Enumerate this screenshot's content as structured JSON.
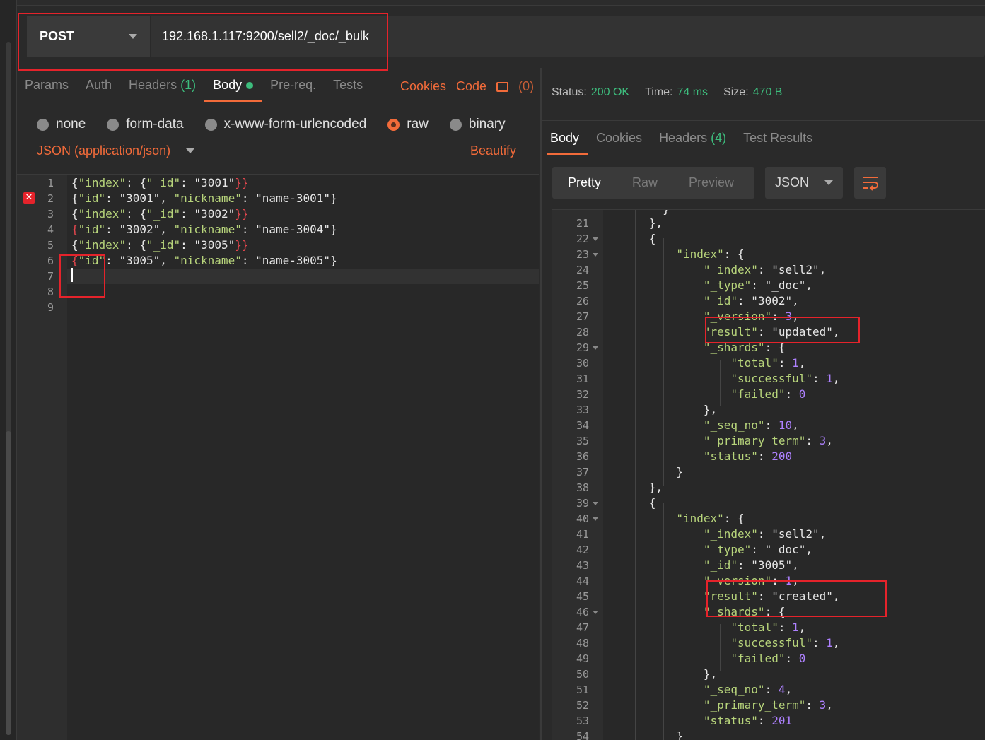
{
  "request": {
    "method": "POST",
    "url": "192.168.1.117:9200/sell2/_doc/_bulk"
  },
  "request_tabs": [
    {
      "label": "Params"
    },
    {
      "label": "Auth"
    },
    {
      "label": "Headers",
      "count": "(1)"
    },
    {
      "label": "Body"
    },
    {
      "label": "Pre-req."
    },
    {
      "label": "Tests"
    }
  ],
  "request_links": {
    "cookies": "Cookies",
    "code": "Code",
    "comments": "(0)"
  },
  "body_types": [
    "none",
    "form-data",
    "x-www-form-urlencoded",
    "raw",
    "binary"
  ],
  "body_type_selected": "raw",
  "content_type": "JSON (application/json)",
  "beautify_label": "Beautify",
  "request_lines": [
    "1",
    "2",
    "3",
    "4",
    "5",
    "6",
    "7",
    "8",
    "9"
  ],
  "response_status": {
    "status_label": "Status:",
    "status_value": "200 OK",
    "time_label": "Time:",
    "time_value": "74 ms",
    "size_label": "Size:",
    "size_value": "470 B"
  },
  "response_tabs": [
    {
      "label": "Body"
    },
    {
      "label": "Cookies"
    },
    {
      "label": "Headers",
      "count": "(4)"
    },
    {
      "label": "Test Results"
    }
  ],
  "response_view": {
    "pretty": "Pretty",
    "raw": "Raw",
    "preview": "Preview",
    "format": "JSON"
  },
  "response_line_numbers": [
    "21",
    "22",
    "23",
    "24",
    "25",
    "26",
    "27",
    "28",
    "29",
    "30",
    "31",
    "32",
    "33",
    "34",
    "35",
    "36",
    "37",
    "38",
    "39",
    "40",
    "41",
    "42",
    "43",
    "44",
    "45",
    "46",
    "47",
    "48",
    "49",
    "50",
    "51",
    "52",
    "53",
    "54"
  ],
  "colors": {
    "accent": "#f26b3a",
    "success": "#3dbd7d",
    "highlight": "#e5232b"
  }
}
